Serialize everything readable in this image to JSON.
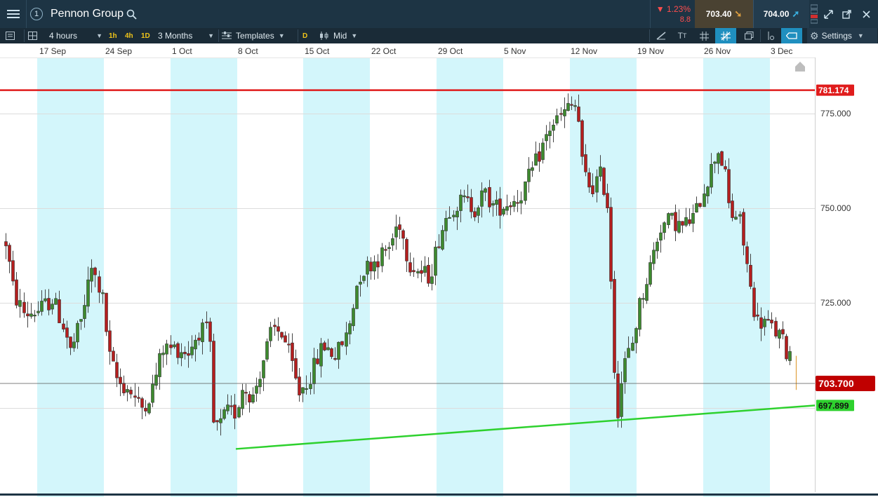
{
  "topbar": {
    "instrument": "Pennon Group",
    "change_pct": "▼ 1.23%",
    "change_abs": "8.8",
    "sell_price": "703.40",
    "buy_price": "704.00"
  },
  "toolbar": {
    "interval": "4 hours",
    "quick_1h": "1h",
    "quick_4h": "4h",
    "quick_1d": "1D",
    "range": "3 Months",
    "templates": "Templates",
    "d_badge": "D",
    "price_type": "Mid",
    "settings": "Settings"
  },
  "chart_data": {
    "type": "candlestick",
    "instrument": "Pennon Group",
    "interval": "4 hours",
    "x_labels": [
      "17 Sep",
      "24 Sep",
      "1 Oct",
      "8 Oct",
      "15 Oct",
      "22 Oct",
      "29 Oct",
      "5 Nov",
      "12 Nov",
      "19 Nov",
      "26 Nov",
      "3 Dec"
    ],
    "y_ticks": [
      "775.000",
      "750.000",
      "725.000"
    ],
    "ylim": [
      688,
      800
    ],
    "current_price": "703.700",
    "resistance_label": "781.174",
    "support_label": "697.899",
    "colors": {
      "up": "#3d8a2e",
      "down": "#b41e1e",
      "resistance": "#e01c1c",
      "support": "#2ed12e",
      "week_shade": "#d3f6fb",
      "current": "#c00000"
    }
  }
}
